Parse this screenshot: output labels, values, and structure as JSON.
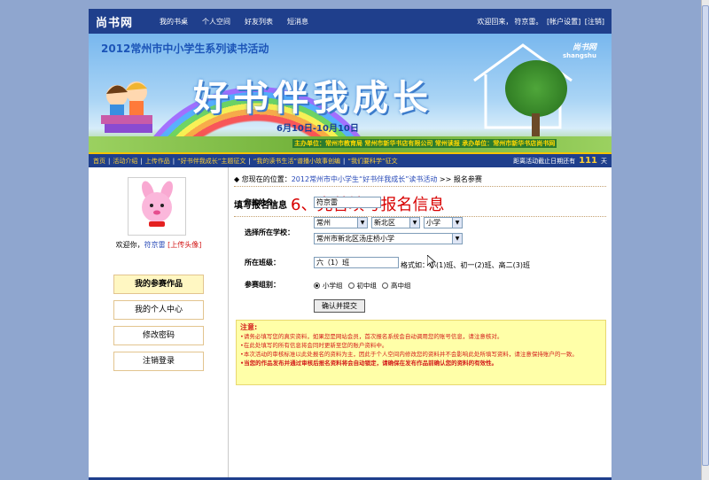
{
  "header": {
    "logo": "尚书网",
    "nav": [
      "我的书桌",
      "个人空间",
      "好友列表",
      "短消息"
    ],
    "welcome_prefix": "欢迎回来，",
    "username": "符京雷",
    "account_settings": "[帐户设置]",
    "logout": "[注销]"
  },
  "banner": {
    "title": "2012常州市中小学生系列读书活动",
    "slogan": "好书伴我成长",
    "dates": "6月10日-10月10日",
    "brand": "尚书网",
    "brand_sub": "shangshu",
    "sponsors": "主办单位：常州市教育局  常州市新华书店有限公司  常州读报  承办单位：常州市新华书店尚书网"
  },
  "activity_bar": {
    "links": [
      "首页",
      "活动介绍",
      "上传作品",
      "“好书伴我成长”主题征文",
      "“我的读书生活”谱播小故事创编",
      "“我们要科学”征文"
    ],
    "countdown_prefix": "距离活动截止日期还有",
    "countdown_days": "111",
    "countdown_suffix": "天"
  },
  "sidebar": {
    "welcome_prefix": "欢迎你，",
    "username": "符京雷",
    "upload_avatar": "[上传头像]",
    "menu": [
      "我的参赛作品",
      "我的个人中心",
      "修改密码",
      "注销登录"
    ]
  },
  "main": {
    "breadcrumb_prefix": "◆ 您现在的位置：",
    "breadcrumb_link": "2012常州市中小学生“好书伴我成长”读书活动",
    "breadcrumb_suffix": " >> 报名参赛",
    "form_title": "填写报名信息",
    "annotation": "6、完善填写报名信息",
    "form": {
      "name_label": "您的姓名：",
      "name_value": "符京雷",
      "school_label": "选择所在学校：",
      "city": "常州",
      "district": "新北区",
      "level": "小学",
      "school": "常州市新北区汤庄桥小学",
      "class_label": "所在班级：",
      "class_value": "六（1）班",
      "class_hint": "格式如：小(1)班、初一(2)班、高二(3)班",
      "group_label": "参赛组别：",
      "groups": [
        "小学组",
        "初中组",
        "高中组"
      ],
      "selected_group": "小学组",
      "submit": "确认并提交"
    },
    "notice": {
      "title": "注意:",
      "items": [
        "•请务必填写您的真实资料，如果您是网站会员，首次报名系统会自动调用您的账号信息，请注意核对。",
        "•在此处填写的所有信息将会同时更新至您的账户资料中。",
        "•本次活动的审核标准以此处报名的资料为主，因此于个人空间内修改您的资料并不会影响此处所填写资料，请注意保持账户的一致。",
        "•当您的作品发布并通过审核后报名资料将会自动锁定，请确保在发布作品前确认您的资料的有效性。"
      ]
    }
  },
  "colors": {
    "nav_blue": "#1f3f8c",
    "annotation_red": "#d80000",
    "notice_bg": "#ffffa8",
    "link_blue": "#2749b7"
  }
}
